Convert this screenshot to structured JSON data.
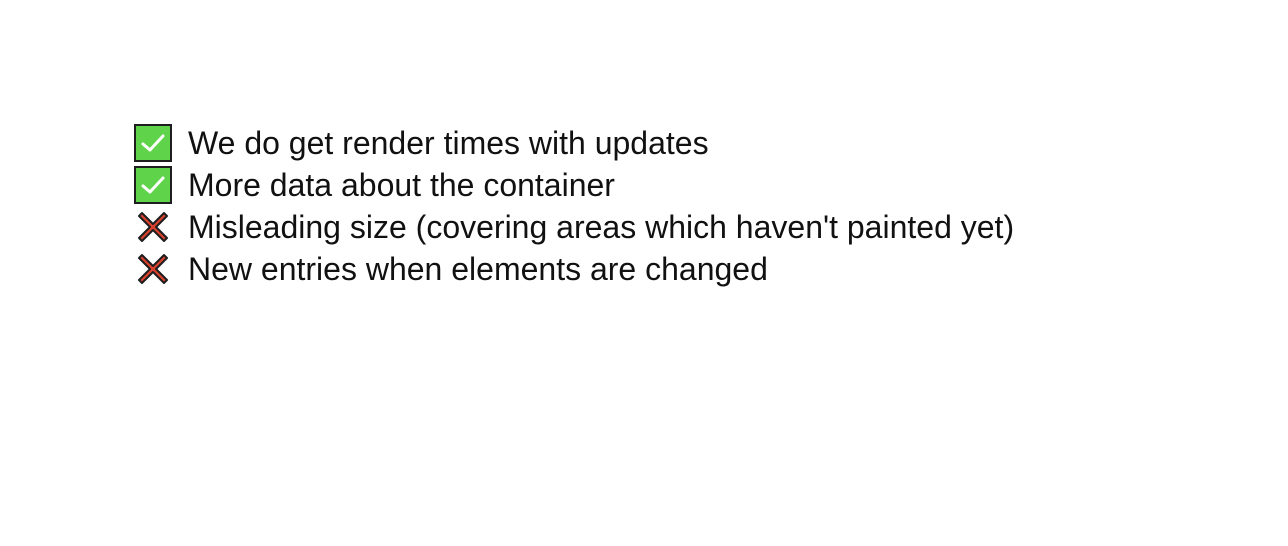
{
  "items": [
    {
      "status": "check",
      "icon": "check-box-icon",
      "text": "We do get render times with updates"
    },
    {
      "status": "check",
      "icon": "check-box-icon",
      "text": "More data about the container"
    },
    {
      "status": "cross",
      "icon": "cross-mark-icon",
      "text": "Misleading size (covering areas which haven't painted yet)"
    },
    {
      "status": "cross",
      "icon": "cross-mark-icon",
      "text": "New entries when elements are changed"
    }
  ],
  "colors": {
    "check": "#5fd44a",
    "cross": "#d9412e"
  }
}
